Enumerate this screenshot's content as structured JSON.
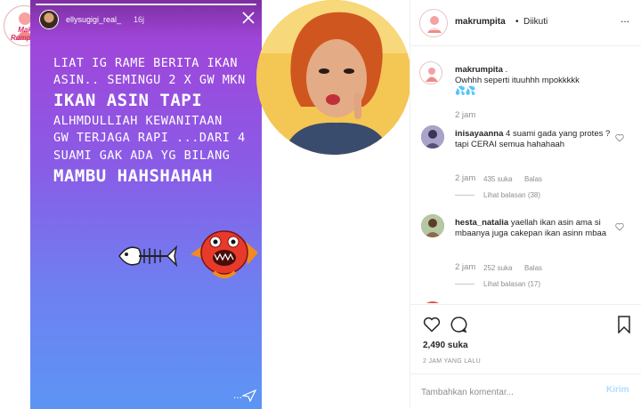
{
  "brand": {
    "logo_line1": "Mak",
    "logo_line2": "Rumpita"
  },
  "story": {
    "username": "ellysugigi_real_",
    "time": "16j",
    "close_icon": "close-icon",
    "lines": [
      {
        "text": "LIAT IG RAME BERITA IKAN",
        "size": "s"
      },
      {
        "text": "ASIN.. SEMINGU 2 X GW MKN",
        "size": "s"
      },
      {
        "text": "IKAN ASIN  TAPI",
        "size": "b"
      },
      {
        "text": "ALHMDULLIAH KEWANITAAN",
        "size": "s"
      },
      {
        "text": "GW TERJAGA RAPI ...DARI 4",
        "size": "s"
      },
      {
        "text": "SUAMI GAK ADA YG BILANG",
        "size": "s"
      },
      {
        "text": "MAMBU HAHSHAHAH",
        "size": "b"
      }
    ],
    "more": "..."
  },
  "post": {
    "username": "makrumpita",
    "dot": "•",
    "follow_status": "Diikuti",
    "more": "..."
  },
  "caption": {
    "username": "makrumpita",
    "suffix": " .",
    "text": "Owhhh seperti ituuhhh mpokkkkk",
    "emoji": "💦💦",
    "time": "2 jam"
  },
  "comments": [
    {
      "username": "inisayaanna",
      "text": "4 suami gada yang protes ? tapi CERAI semua hahahaah",
      "time": "2 jam",
      "likes": "435 suka",
      "reply": "Balas",
      "view_replies": "Lihat balasan (38)"
    },
    {
      "username": "hesta_natalia",
      "text": "yaellah ikan asin ama si mbaanya juga cakepan ikan asinn mbaa",
      "time": "2 jam",
      "likes": "252 suka",
      "reply": "Balas",
      "view_replies": "Lihat balasan (17)"
    }
  ],
  "actions": {
    "likes": "2,490 suka",
    "time": "2 JAM YANG LALU"
  },
  "add_comment": {
    "placeholder": "Tambahkan komentar...",
    "post_label": "Kirim"
  }
}
